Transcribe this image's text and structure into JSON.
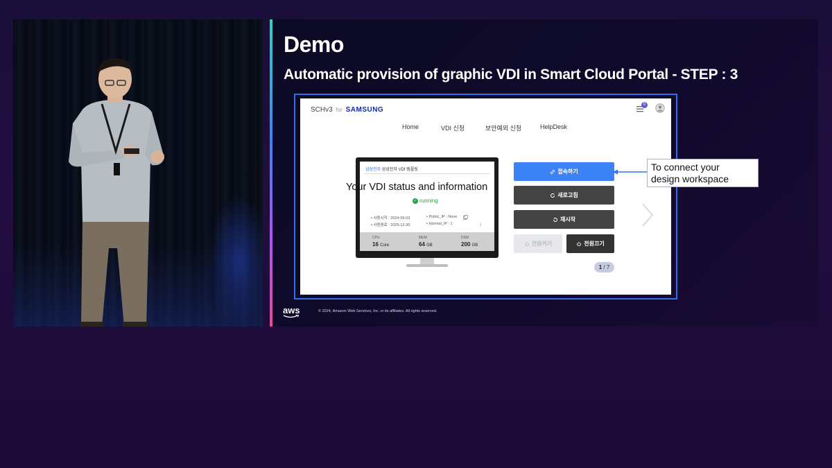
{
  "slide": {
    "title": "Demo",
    "subtitle": "Automatic provision of graphic VDI in Smart Cloud Portal - STEP : 3",
    "copyright": "© 2024, Amazon Web Services, Inc. or its affiliates. All rights reserved.",
    "aws_logo_text": "aws"
  },
  "portal": {
    "brand": {
      "sch": "SCHv3",
      "for": "for",
      "samsung": "SAMSUNG"
    },
    "notification_count": "0",
    "nav": [
      "Home",
      "VDI 신청",
      "보안예외 신청",
      "HelpDesk"
    ],
    "vdi_card": {
      "header_brand": "삼성전자",
      "header_text": "삼성전자 VDI 템플릿",
      "status": "running",
      "start_date_label": "• 사용시작 : 2024-09-03",
      "end_date_label": "• 사용종료 : 2025-12-30",
      "public_ip": "• Public_IP : None",
      "internal_ip": "• Internal_IP : 1",
      "stats": [
        {
          "label": "CPU",
          "value": "16",
          "unit": "Core"
        },
        {
          "label": "MEM",
          "value": "64",
          "unit": "GB"
        },
        {
          "label": "DISK",
          "value": "200",
          "unit": "GB"
        }
      ]
    },
    "overlay_label": "Your VDI status and information",
    "buttons": {
      "connect": "접속하기",
      "refresh": "새로고침",
      "restart": "재시작",
      "power_on": "전원켜기",
      "power_off": "전원끄기"
    },
    "pager": {
      "current": "1",
      "total": "/ 7"
    }
  },
  "callout": {
    "line1": "To connect your",
    "line2": "design workspace"
  },
  "colors": {
    "accent_blue": "#3b82f6",
    "dark_button": "#444444",
    "frame_blue": "#2f6ff0",
    "samsung_blue": "#1428a0",
    "running_green": "#2ea043"
  },
  "icons": [
    "link-icon",
    "refresh-icon",
    "restart-icon",
    "power-icon",
    "list-icon",
    "user-icon",
    "chevron-right-icon"
  ]
}
